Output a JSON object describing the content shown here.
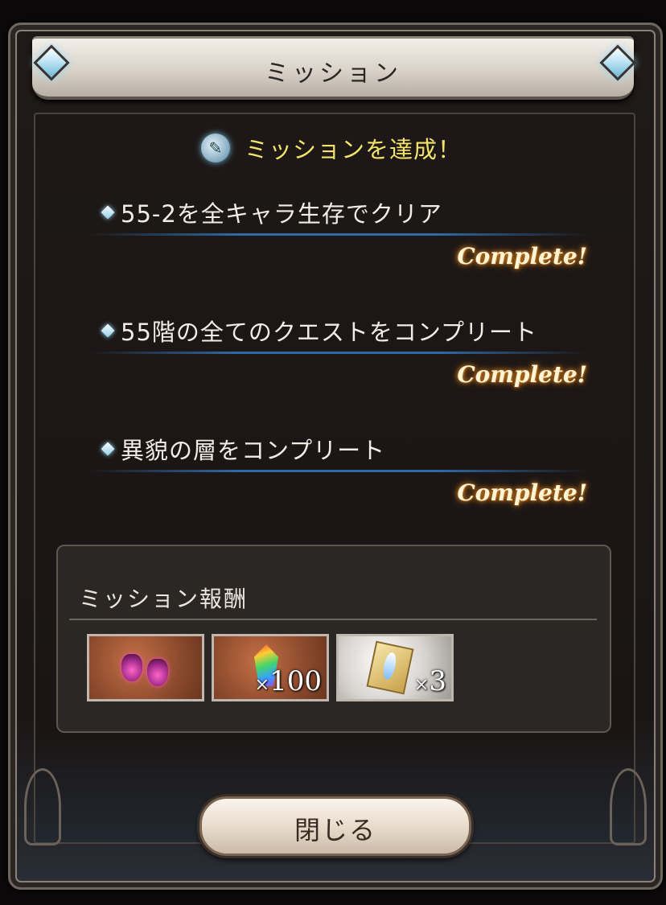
{
  "dialog": {
    "title": "ミッション"
  },
  "achieve": {
    "icon": "scroll-icon",
    "text": "ミッションを達成！"
  },
  "missions": [
    {
      "text": "55-2を全キャラ生存でクリア",
      "status": "Complete!"
    },
    {
      "text": "55階の全てのクエストをコンプリート",
      "status": "Complete!"
    },
    {
      "text": "異貌の層をコンプリート",
      "status": "Complete!"
    }
  ],
  "rewards": {
    "title": "ミッション報酬",
    "items": [
      {
        "icon": "earrings-icon",
        "quantity": ""
      },
      {
        "icon": "rainbow-crystal-icon",
        "quantity_prefix": "×",
        "quantity": "100"
      },
      {
        "icon": "crystal-ticket-icon",
        "quantity_prefix": "×",
        "quantity": "3"
      }
    ]
  },
  "close_button": {
    "label": "閉じる"
  },
  "colors": {
    "achieve_text": "#f2e36a",
    "complete_glow": "#d8871c",
    "underline": "#2f6aa6"
  }
}
